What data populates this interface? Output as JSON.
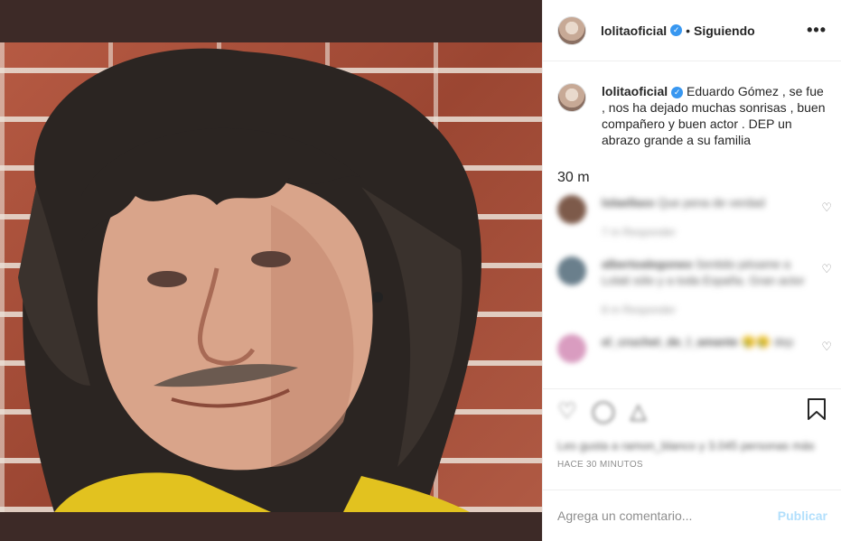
{
  "post": {
    "username": "lolitaoficial",
    "verified_glyph": "✓",
    "separator": "•",
    "follow_state": "Siguiendo",
    "more_label": "•••"
  },
  "caption": {
    "username": "lolitaoficial",
    "text": "Eduardo Gómez , se fue , nos ha dejado muchas sonrisas , buen compañero y buen actor . DEP un abrazo grande a su familia",
    "time": "30 m"
  },
  "comments": [
    {
      "user": "lolaellaxx",
      "text": "Que pena de verdad",
      "meta": "7 m   Responder",
      "avatar_color": "#7d5a4a"
    },
    {
      "user": "albertoalegoneo",
      "text": "Sentido pésame a Lolati sólo y a toda España. Gran actor",
      "meta": "8 m   Responder",
      "avatar_color": "#6a7f8c"
    },
    {
      "user": "el_cruchet_de_l_amante",
      "text": "😢😢 dep",
      "meta": "",
      "avatar_color": "#d99cc0"
    }
  ],
  "actions": {
    "likes_text": "Les gusta a ramon_blanco y 3.045 personas más",
    "posted_ago": "HACE 30 MINUTOS"
  },
  "add_comment": {
    "placeholder": "Agrega un comentario...",
    "publish_label": "Publicar"
  }
}
